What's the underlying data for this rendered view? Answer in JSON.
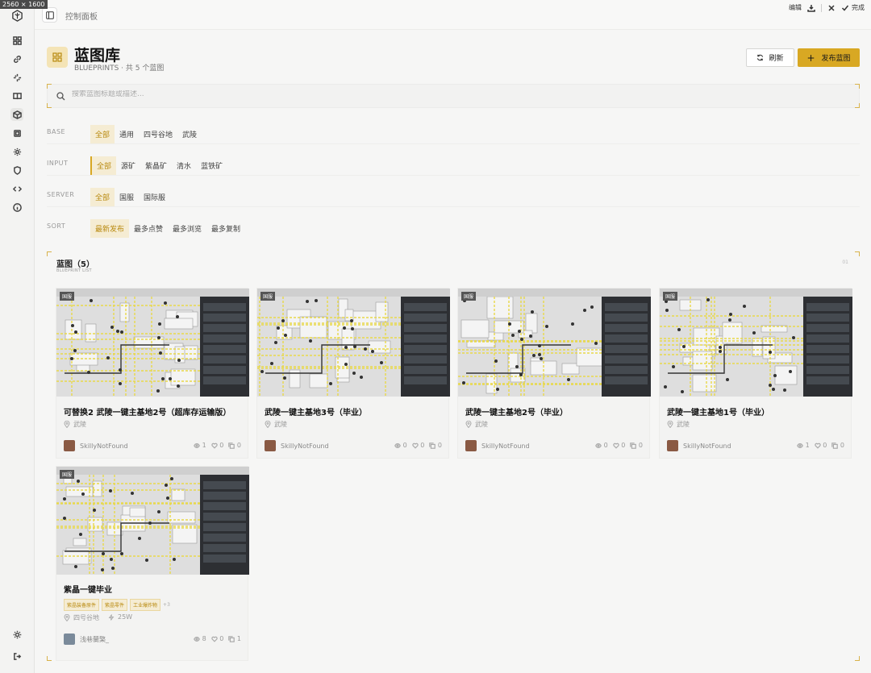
{
  "screen_size_badge": "2560 × 1600",
  "topbar": {
    "breadcrumb": "控制面板",
    "edit_label": "编辑",
    "done_label": "完成"
  },
  "header": {
    "title": "蓝图库",
    "subtitle": "BLUEPRINTS · 共 5 个蓝图",
    "refresh_label": "刷新",
    "publish_label": "发布蓝图"
  },
  "search": {
    "placeholder": "搜索蓝图标题或描述..."
  },
  "filters": [
    {
      "label": "BASE",
      "options": [
        "全部",
        "通用",
        "四号谷地",
        "武陵"
      ]
    },
    {
      "label": "INPUT",
      "options": [
        "全部",
        "源矿",
        "紫晶矿",
        "清水",
        "蓝铁矿"
      ]
    },
    {
      "label": "SERVER",
      "options": [
        "全部",
        "国服",
        "国际服"
      ]
    },
    {
      "label": "SORT",
      "options": [
        "最新发布",
        "最多点赞",
        "最多浏览",
        "最多复制"
      ]
    }
  ],
  "list": {
    "title": "蓝图（5）",
    "subtitle": "BLUEPRINT LIST",
    "index": "01"
  },
  "cards": [
    {
      "server_tag": "国服",
      "title": "可替换2 武陵一键主基地2号（超库存运输版）",
      "location": "武陵",
      "user": "SkillyNotFound",
      "views": "1",
      "likes": "0",
      "copies": "0"
    },
    {
      "server_tag": "国服",
      "title": "武陵一键主基地3号（毕业）",
      "location": "武陵",
      "user": "SkillyNotFound",
      "views": "0",
      "likes": "0",
      "copies": "0"
    },
    {
      "server_tag": "国服",
      "title": "武陵一键主基地2号（毕业）",
      "location": "武陵",
      "user": "SkillyNotFound",
      "views": "0",
      "likes": "0",
      "copies": "0"
    },
    {
      "server_tag": "国服",
      "title": "武陵一键主基地1号（毕业）",
      "location": "武陵",
      "user": "SkillyNotFound",
      "views": "1",
      "likes": "0",
      "copies": "0"
    },
    {
      "server_tag": "国服",
      "title": "紫晶一键毕业",
      "tags": [
        "紫晶装备原件",
        "紫晶零件",
        "工业爆炸物"
      ],
      "more": "+3",
      "location": "四号谷地",
      "power": "25W",
      "user": "浅巷蘭檠_",
      "views": "8",
      "likes": "0",
      "copies": "1"
    }
  ],
  "colors": {
    "accent": "#d8a823",
    "accent_bg": "#f5ecd3"
  }
}
